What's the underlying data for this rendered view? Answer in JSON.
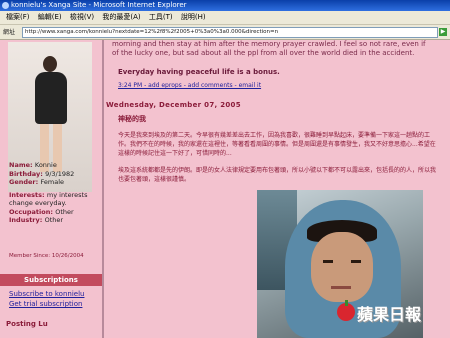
{
  "window": {
    "title": "konnielu's Xanga Site - Microsoft Internet Explorer"
  },
  "menubar": {
    "items": [
      "檔案(F)",
      "編輯(E)",
      "檢視(V)",
      "我的最愛(A)",
      "工具(T)",
      "說明(H)"
    ]
  },
  "address": {
    "label": "網址",
    "url": "http://www.xanga.com/konnielu?nextdate=12%2f8%2f2005+0%3a0%3a0.000&direction=n"
  },
  "sidebar": {
    "profile": {
      "name_label": "Name:",
      "name": "Konnie",
      "birthday_label": "Birthday:",
      "birthday": "9/3/1982",
      "gender_label": "Gender:",
      "gender": "Female",
      "interests_label": "Interests:",
      "interests": "my interests change everyday.",
      "occupation_label": "Occupation:",
      "occupation": "Other",
      "industry_label": "Industry:",
      "industry": "Other"
    },
    "member_since": "Member Since: 10/26/2004",
    "subscriptions": {
      "heading": "Subscriptions",
      "links": [
        "Subscribe to konnielu",
        "Get trial subscription"
      ]
    },
    "bottom_label": "Posting Lu"
  },
  "main": {
    "intro": "morning and then stay at him after the memory prayer crawled. I feel so not rare, even if of the lucky one, but sad about all the ppl from all over the world died in the accident.",
    "bonus": "Everyday having peaceful life is a bonus.",
    "post_meta": "3:24 PM - add eprops - add comments - email it",
    "date": "Wednesday, December 07, 2005",
    "post_title": "神秘的我",
    "body1": "今天是我來到埃及的第二天。今早很有幾差差出去工作，因為我喜歡，很難睡到早點起床，要準備一下家這一趟點的工作。我們不在的時候，我的家還在這裡住，等著看看周圍的事情。但是周圍還是有事情發生，我又不好意思擔心...希望在這樣的時候記住這一下好了，可惜同時的...",
    "body2": "埃及這系統都都是先的伊朗。即是的女人法律規定要用布包著頭，所以小號以下都不可以露出來，包括長的的人，所以我也要包著頭，這樣很謹慎。"
  },
  "watermark": {
    "text": "蘋果日報"
  }
}
